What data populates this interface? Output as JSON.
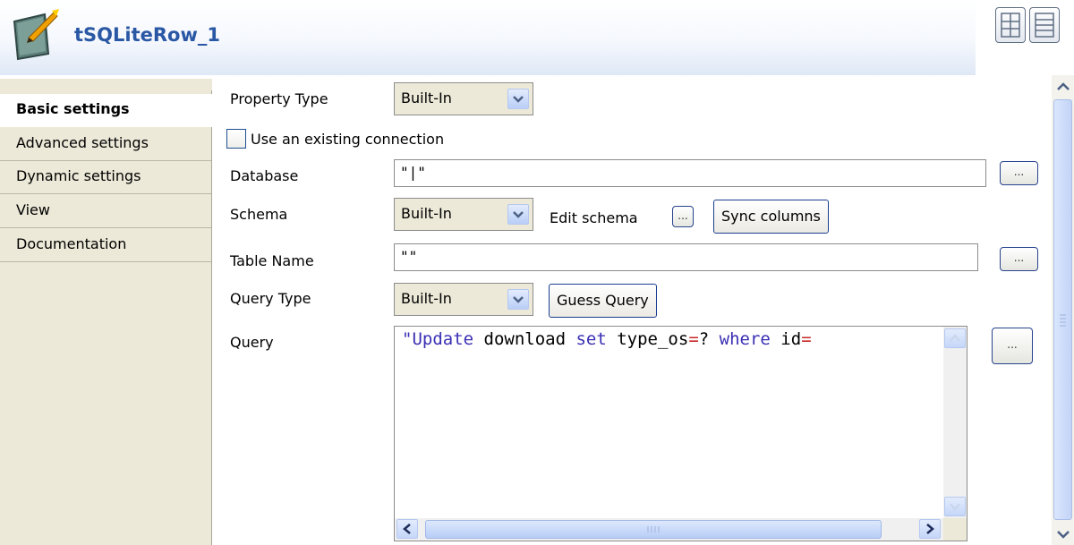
{
  "header": {
    "component_icon": "tsqliterow-component-icon",
    "title": "tSQLiteRow_1",
    "layout_buttons": [
      "table-layout-icon",
      "list-layout-icon"
    ]
  },
  "sidebar": {
    "items": [
      {
        "label": "Basic settings",
        "active": true
      },
      {
        "label": "Advanced settings",
        "active": false
      },
      {
        "label": "Dynamic settings",
        "active": false
      },
      {
        "label": "View",
        "active": false
      },
      {
        "label": "Documentation",
        "active": false
      }
    ]
  },
  "form": {
    "property_type": {
      "label": "Property Type",
      "value": "Built-In"
    },
    "use_existing_connection": {
      "label": "Use an existing connection",
      "checked": false
    },
    "database": {
      "label": "Database",
      "value": "\"|\"",
      "browse_label": "..."
    },
    "schema": {
      "label": "Schema",
      "value": "Built-In",
      "edit_label": "Edit schema",
      "edit_btn": "...",
      "sync_label": "Sync columns"
    },
    "table_name": {
      "label": "Table Name",
      "value": "\"\"",
      "browse_label": "..."
    },
    "query_type": {
      "label": "Query Type",
      "value": "Built-In",
      "guess_label": "Guess Query"
    },
    "query": {
      "label": "Query",
      "value": "\"Update download set type_os=? where id=",
      "tokens": [
        {
          "text": "\"Update",
          "kind": "kw"
        },
        {
          "text": " download ",
          "kind": "plain"
        },
        {
          "text": "set",
          "kind": "kw"
        },
        {
          "text": " type_os",
          "kind": "plain"
        },
        {
          "text": "=",
          "kind": "op"
        },
        {
          "text": "? ",
          "kind": "plain"
        },
        {
          "text": "where",
          "kind": "kw"
        },
        {
          "text": " id",
          "kind": "plain"
        },
        {
          "text": "=",
          "kind": "op"
        }
      ],
      "editor_btn": "..."
    }
  },
  "colors": {
    "title": "#2a58a4",
    "keyword": "#3a2fb3",
    "operator": "#c62828",
    "sidebar_bg": "#ece9d8"
  }
}
